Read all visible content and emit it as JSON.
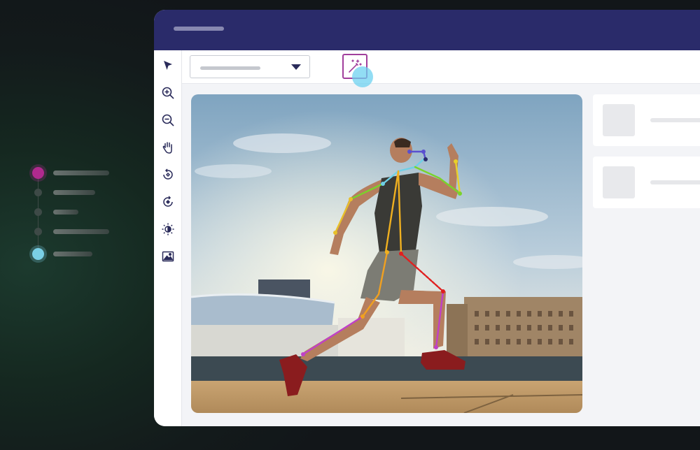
{
  "steps": [
    {
      "state": "active-start"
    },
    {
      "state": "idle"
    },
    {
      "state": "idle"
    },
    {
      "state": "idle"
    },
    {
      "state": "active-end"
    }
  ],
  "toolbar": {
    "tools": [
      "select-arrow-icon",
      "zoom-in-icon",
      "zoom-out-icon",
      "pan-hand-icon",
      "rotate-right-icon",
      "rotate-left-icon",
      "brightness-icon",
      "image-icon"
    ],
    "dropdown_value": "",
    "auto_annotate_icon": "magic-wand-icon"
  },
  "canvas": {
    "subject": "runner-pose-keypoints",
    "skeleton_colors": {
      "head": "#5a4fcf",
      "neck": "#6fd0e6",
      "right_arm": "#7ad32a",
      "right_forearm": "#e8d02a",
      "left_arm": "#e8c02a",
      "left_forearm": "#f0a020",
      "torso": "#f0b020",
      "left_leg": "#e8a020",
      "left_shin": "#c040c8",
      "right_thigh": "#e02020",
      "right_shin": "#c040c8"
    }
  },
  "colors": {
    "titlebar": "#2a2b6a",
    "accent_magenta": "#a13f9c",
    "cursor_cyan": "#6ed2f0"
  }
}
